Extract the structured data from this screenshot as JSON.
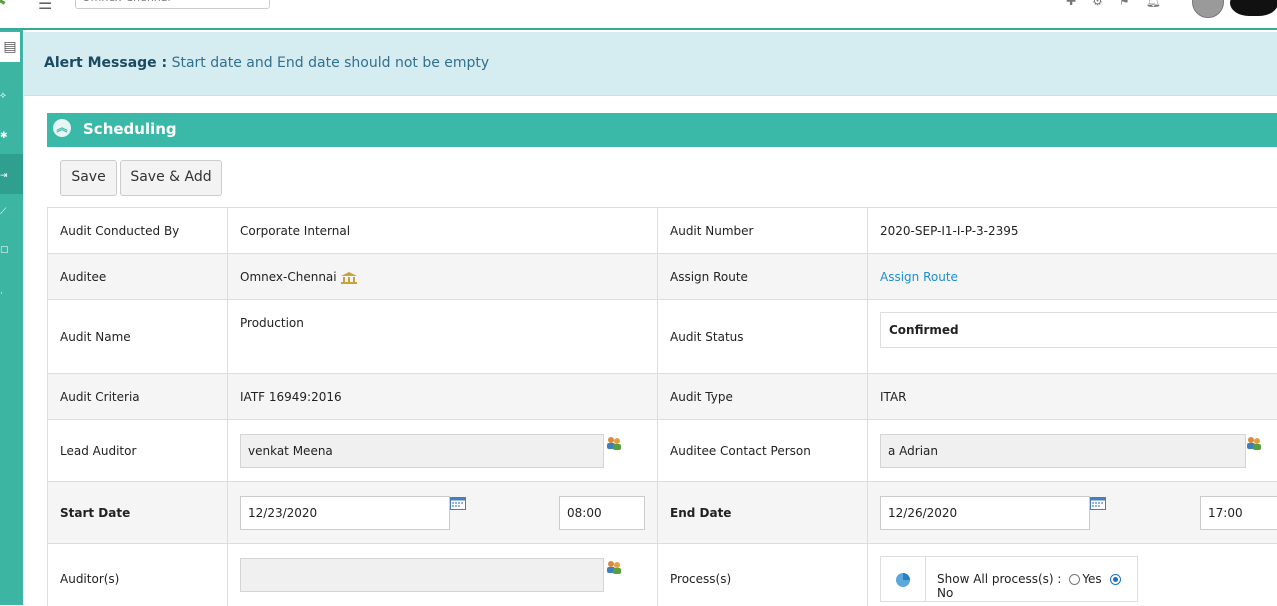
{
  "header": {
    "search_value": "Omnex-Chennai"
  },
  "alert": {
    "label": "Alert Message :",
    "message": "Start date and End date should not be empty"
  },
  "panel": {
    "title": "Scheduling"
  },
  "toolbar": {
    "save_label": "Save",
    "save_add_label": "Save & Add"
  },
  "form": {
    "audit_conducted_by": {
      "label": "Audit Conducted By",
      "value": "Corporate Internal"
    },
    "audit_number": {
      "label": "Audit Number",
      "value": "2020-SEP-I1-I-P-3-2395"
    },
    "auditee": {
      "label": "Auditee",
      "value": "Omnex-Chennai"
    },
    "assign_route": {
      "label": "Assign Route",
      "link": "Assign Route"
    },
    "audit_name": {
      "label": "Audit Name",
      "value": "Production"
    },
    "audit_status": {
      "label": "Audit Status",
      "value": "Confirmed"
    },
    "audit_criteria": {
      "label": "Audit Criteria",
      "value": "IATF 16949:2016"
    },
    "audit_type": {
      "label": "Audit Type",
      "value": "ITAR"
    },
    "lead_auditor": {
      "label": "Lead Auditor",
      "value": "venkat Meena"
    },
    "auditee_contact": {
      "label": "Auditee Contact Person",
      "value": "a Adrian"
    },
    "start_date": {
      "label": "Start Date",
      "date": "12/23/2020",
      "time": "08:00"
    },
    "end_date": {
      "label": "End Date",
      "date": "12/26/2020",
      "time": "17:00"
    },
    "auditors": {
      "label": "Auditor(s)",
      "value": ""
    },
    "process": {
      "label": "Process(s)",
      "show_all": "Show All process(s) :",
      "yes": "Yes",
      "no": "No",
      "selected": "No"
    }
  },
  "icons": [
    "gear-icon",
    "hamburger-icon",
    "bell-icon",
    "settings-icon",
    "avatar",
    "document-icon",
    "bank-icon",
    "people-picker-icon",
    "calendar-icon",
    "pie-icon",
    "collapse-icon"
  ]
}
